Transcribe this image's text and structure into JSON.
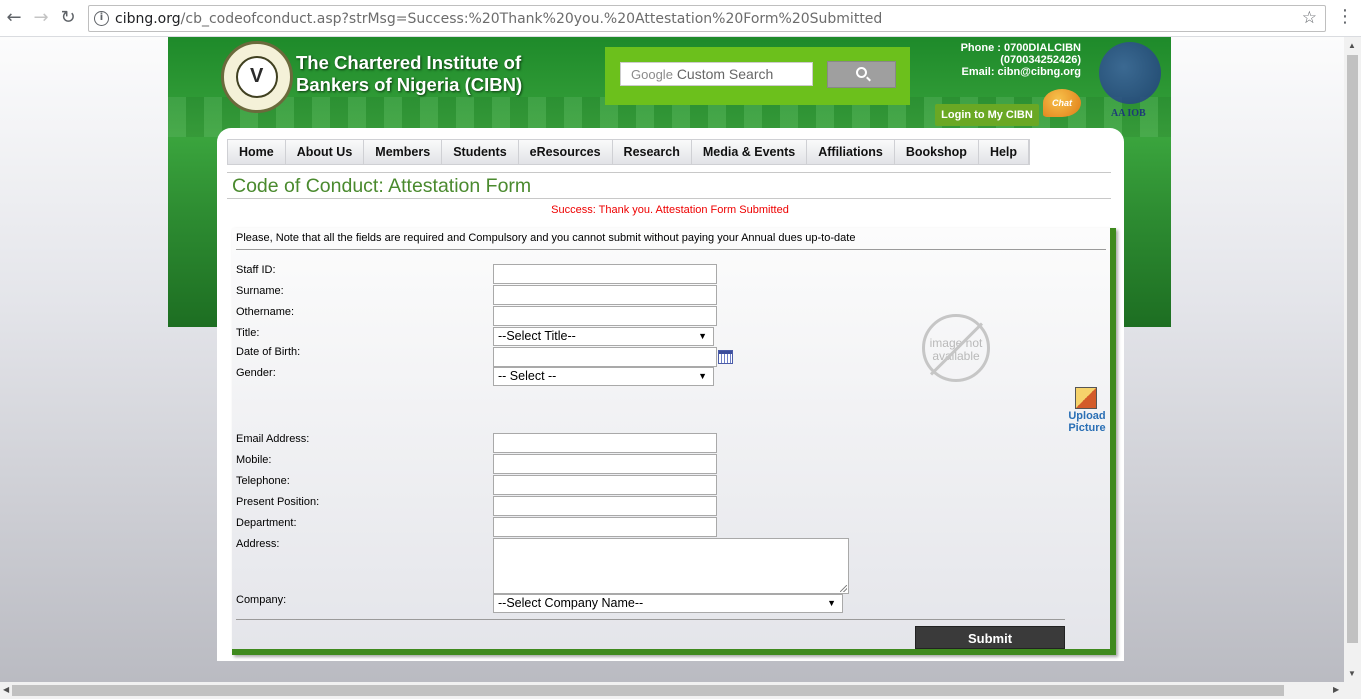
{
  "browser": {
    "url_domain": "cibng.org",
    "url_path": "/cb_codeofconduct.asp?strMsg=Success:%20Thank%20you.%20Attestation%20Form%20Submitted"
  },
  "header": {
    "org_name_line1": "The Chartered Institute of",
    "org_name_line2": "Bankers of Nigeria (CIBN)",
    "search_google": "Google",
    "search_placeholder": "Custom Search",
    "contact_phone": "Phone : 0700DIALCIBN",
    "contact_alt": "(070034252426)",
    "contact_email": "Email: cibn@cibng.org",
    "login_label": "Login to My CIBN",
    "chat_label": "Chat",
    "aacb_label": "AA  IOB"
  },
  "menu": {
    "items": [
      "Home",
      "About Us",
      "Members",
      "Students",
      "eResources",
      "Research",
      "Media & Events",
      "Affiliations",
      "Bookshop",
      "Help"
    ]
  },
  "page": {
    "title": "Code of Conduct: Attestation Form",
    "success": "Success: Thank you. Attestation Form Submitted",
    "note": "Please, Note that all the fields are required and Compulsory and you cannot submit without paying your Annual dues up-to-date"
  },
  "form": {
    "staff_id": "Staff ID:",
    "surname": "Surname:",
    "othername": "Othername:",
    "title": "Title:",
    "title_value": "--Select Title--",
    "dob": "Date of Birth:",
    "gender": "Gender:",
    "gender_value": "-- Select --",
    "email": "Email Address:",
    "mobile": "Mobile:",
    "telephone": "Telephone:",
    "position": "Present Position:",
    "department": "Department:",
    "address": "Address:",
    "company": "Company:",
    "company_value": "--Select Company Name--",
    "no_image_text": "image not available",
    "upload_label": "Upload Picture",
    "submit_label": "Submit"
  },
  "colors": {
    "banner_green": "#2e8d32",
    "title_green": "#4a8a2e",
    "success_red": "#e00000",
    "search_green": "#6cc01c"
  }
}
